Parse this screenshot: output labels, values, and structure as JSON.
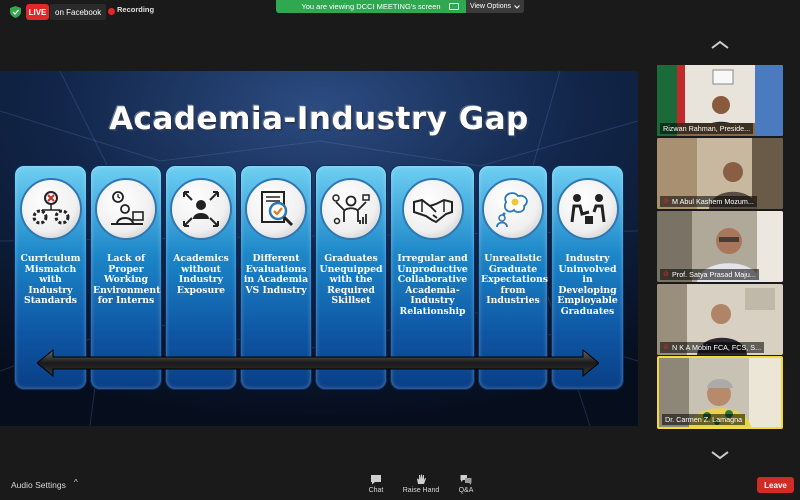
{
  "topbar": {
    "live_label": "LIVE",
    "facebook_label": "on Facebook",
    "recording_label": "Recording",
    "viewing_banner": "You are viewing DCCI MEETING's screen",
    "view_options_label": "View Options"
  },
  "slide": {
    "title": "Academia-Industry Gap",
    "panels": [
      {
        "icon": "mismatch-gears-icon",
        "text": "Curriculum Mismatch with Industry Standards"
      },
      {
        "icon": "intern-desk-icon",
        "text": "Lack of Proper Working Environment for Interns"
      },
      {
        "icon": "exposure-person-icon",
        "text": "Academics without Industry Exposure"
      },
      {
        "icon": "evaluation-magnifier-icon",
        "text": "Different Evaluations in Academia VS Industry"
      },
      {
        "icon": "skillset-person-icon",
        "text": "Graduates Unequipped with the Required Skillset"
      },
      {
        "icon": "handshake-icon",
        "text": "Irregular and Unproductive Collaborative Academia-Industry Relationship"
      },
      {
        "icon": "thought-bubble-icon",
        "text": "Unrealistic Graduate Expectations from Industries"
      },
      {
        "icon": "developing-people-icon",
        "text": "Industry Uninvolved in Developing Employable Graduates"
      }
    ]
  },
  "participants": [
    {
      "name": "Rizwan Rahman, Preside...",
      "muted": false
    },
    {
      "name": "M Abul Kashem Mozum...",
      "muted": true
    },
    {
      "name": "Prof. Satya Prasad Maju...",
      "muted": true
    },
    {
      "name": "N K A Mobin FCA, FCS, S...",
      "muted": true
    },
    {
      "name": "Dr. Carmen Z. Lamagna",
      "muted": false
    }
  ],
  "toolbar": {
    "audio_settings_label": "Audio Settings",
    "chat_label": "Chat",
    "raise_hand_label": "Raise Hand",
    "qa_label": "Q&A",
    "leave_label": "Leave"
  },
  "colors": {
    "live_red": "#e02828",
    "viewing_green": "#2fa84f",
    "active_speaker_yellow": "#f5d83a",
    "leave_red": "#d02b24"
  }
}
